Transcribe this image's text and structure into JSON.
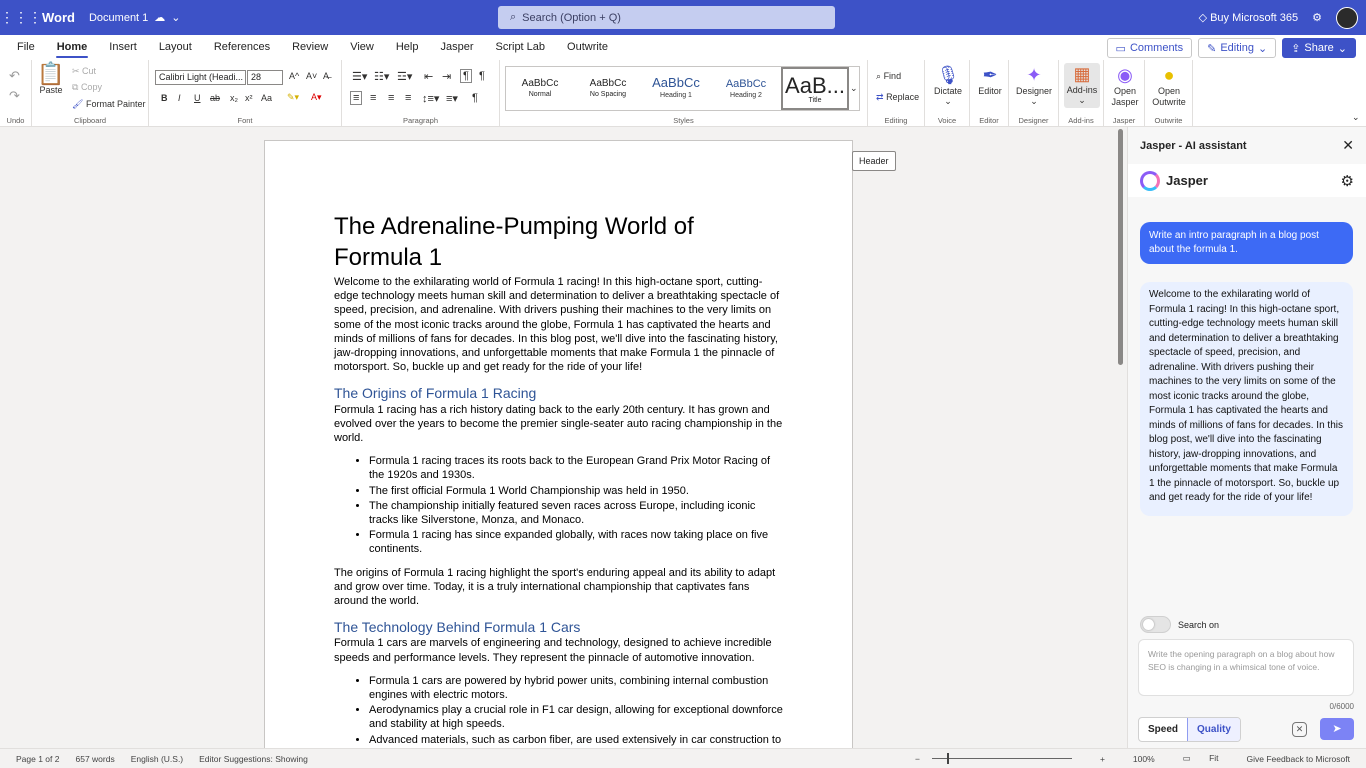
{
  "titlebar": {
    "app": "Word",
    "document": "Document 1",
    "search_placeholder": "Search (Option + Q)",
    "buy": "Buy Microsoft 365"
  },
  "menu": {
    "tabs": [
      "File",
      "Home",
      "Insert",
      "Layout",
      "References",
      "Review",
      "View",
      "Help",
      "Jasper",
      "Script Lab",
      "Outwrite"
    ],
    "comments": "Comments",
    "editing": "Editing",
    "share": "Share"
  },
  "ribbon": {
    "undo_group": "Undo",
    "clipboard": {
      "paste": "Paste",
      "cut": "Cut",
      "copy": "Copy",
      "format_painter": "Format Painter",
      "label": "Clipboard"
    },
    "font": {
      "name": "Calibri Light (Headi...",
      "size": "28",
      "label": "Font",
      "bold": "B",
      "italic": "I",
      "underline": "U",
      "strike": "ab",
      "sub": "x₂",
      "sup": "x²",
      "case": "Aa",
      "grow": "A^",
      "shrink": "A˅"
    },
    "paragraph": {
      "label": "Paragraph"
    },
    "styles": {
      "label": "Styles",
      "items": [
        {
          "sample": "AaBbCc",
          "name": "Normal"
        },
        {
          "sample": "AaBbCc",
          "name": "No Spacing"
        },
        {
          "sample": "AaBbCc",
          "name": "Heading 1"
        },
        {
          "sample": "AaBbCc",
          "name": "Heading 2"
        },
        {
          "sample": "AaB...",
          "name": "Title"
        }
      ]
    },
    "editing": {
      "find": "Find",
      "replace": "Replace",
      "label": "Editing"
    },
    "voice": {
      "dictate": "Dictate",
      "label": "Voice"
    },
    "editor": {
      "editor": "Editor",
      "label": "Editor"
    },
    "designer": {
      "designer": "Designer",
      "label": "Designer"
    },
    "addins": {
      "addins": "Add-ins",
      "label": "Add-ins"
    },
    "jasper": {
      "open": "Open Jasper",
      "label": "Jasper"
    },
    "outwrite": {
      "open": "Open Outwrite",
      "label": "Outwrite"
    }
  },
  "document": {
    "header_tag": "Header",
    "title": "The Adrenaline-Pumping World of Formula 1",
    "intro": "Welcome to the exhilarating world of Formula 1 racing! In this high-octane sport, cutting-edge technology meets human skill and determination to deliver a breathtaking spectacle of speed, precision, and adrenaline. With drivers pushing their machines to the very limits on some of the most iconic tracks around the globe, Formula 1 has captivated the hearts and minds of millions of fans for decades. In this blog post, we'll dive into the fascinating history, jaw-dropping innovations, and unforgettable moments that make Formula 1 the pinnacle of motorsport. So, buckle up and get ready for the ride of your life!",
    "h2_origins": "The Origins of Formula 1 Racing",
    "origins_p": "Formula 1 racing has a rich history dating back to the early 20th century. It has grown and evolved over the years to become the premier single-seater auto racing championship in the world.",
    "origins_list": [
      "Formula 1 racing traces its roots back to the European Grand Prix Motor Racing of the 1920s and 1930s.",
      "The first official Formula 1 World Championship was held in 1950.",
      "The championship initially featured seven races across Europe, including iconic tracks like Silverstone, Monza, and Monaco.",
      "Formula 1 racing has since expanded globally, with races now taking place on five continents."
    ],
    "origins_p2": "The origins of Formula 1 racing highlight the sport's enduring appeal and its ability to adapt and grow over time. Today, it is a truly international championship that captivates fans around the world.",
    "h2_tech": "The Technology Behind Formula 1 Cars",
    "tech_p": "Formula 1 cars are marvels of engineering and technology, designed to achieve incredible speeds and performance levels. They represent the pinnacle of automotive innovation.",
    "tech_list": [
      "Formula 1 cars are powered by hybrid power units, combining internal combustion engines with electric motors.",
      "Aerodynamics play a crucial role in F1 car design, allowing for exceptional downforce and stability at high speeds.",
      "Advanced materials, such as carbon fiber, are used extensively in car construction to"
    ]
  },
  "panel": {
    "title": "Jasper - AI assistant",
    "brand": "Jasper",
    "user_msg": "Write an intro paragraph in a blog post about the formula 1.",
    "ai_msg": "Welcome to the exhilarating world of Formula 1 racing! In this high-octane sport, cutting-edge technology meets human skill and determination to deliver a breathtaking spectacle of speed, precision, and adrenaline. With drivers pushing their machines to the very limits on some of the most iconic tracks around the globe, Formula 1 has captivated the hearts and minds of millions of fans for decades. In this blog post, we'll dive into the fascinating history, jaw-dropping innovations, and unforgettable moments that make Formula 1 the pinnacle of motorsport. So, buckle up and get ready for the ride of your life!",
    "search_toggle": "Search on",
    "prompt_placeholder": "Write the opening paragraph on a blog about how SEO is changing in a whimsical tone of voice.",
    "count": "0/6000",
    "speed": "Speed",
    "quality": "Quality"
  },
  "status": {
    "page": "Page 1 of 2",
    "words": "657 words",
    "lang": "English (U.S.)",
    "suggestions": "Editor Suggestions: Showing",
    "zoom": "100%",
    "fit": "Fit",
    "feedback": "Give Feedback to Microsoft"
  }
}
